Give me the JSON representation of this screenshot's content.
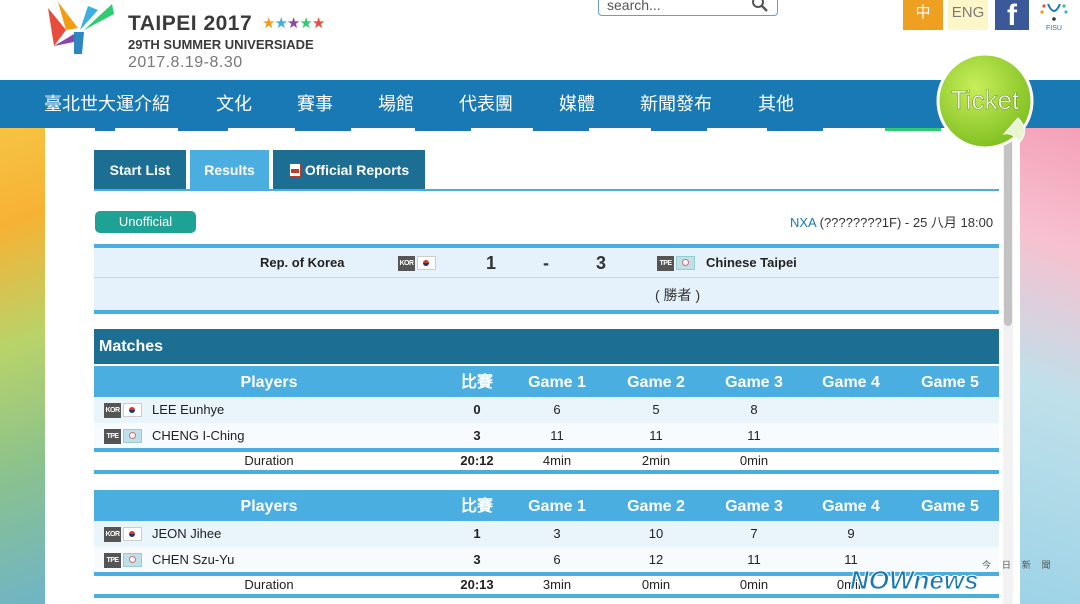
{
  "header": {
    "logo_title": "TAIPEI 2017",
    "logo_subtitle": "29TH SUMMER UNIVERSIADE",
    "logo_dates": "2017.8.19-8.30",
    "search_placeholder": "search...",
    "lang_zh": "中",
    "lang_en": "ENG",
    "fisu_label": "FISU"
  },
  "nav": {
    "items": [
      "臺北世大運介紹",
      "文化",
      "賽事",
      "場館",
      "代表團",
      "媒體",
      "新聞發布",
      "其他"
    ],
    "ticket_label": "Ticket"
  },
  "tabs": {
    "start_list": "Start List",
    "results": "Results",
    "official_reports": "Official Reports"
  },
  "status_badge": "Unofficial",
  "venue": {
    "link": "NXA",
    "detail": " (????????1F) - 25 八月 18:00"
  },
  "score": {
    "team_a": "Rep. of Korea",
    "team_a_code": "KOR",
    "score_a": "1",
    "dash": "-",
    "score_b": "3",
    "team_b": "Chinese Taipei",
    "team_b_code": "TPE",
    "winner_note": "( 勝者 )"
  },
  "matches": {
    "title": "Matches",
    "headers": [
      "Players",
      "比賽",
      "Game 1",
      "Game 2",
      "Game 3",
      "Game 4",
      "Game 5"
    ],
    "duration_label": "Duration",
    "blocks": [
      {
        "rows": [
          {
            "code": "KOR",
            "name": "LEE Eunhye",
            "match": "0",
            "g1": "6",
            "g2": "5",
            "g3": "8",
            "g4": "",
            "g5": ""
          },
          {
            "code": "TPE",
            "name": "CHENG I-Ching",
            "match": "3",
            "g1": "11",
            "g2": "11",
            "g3": "11",
            "g4": "",
            "g5": ""
          }
        ],
        "duration": {
          "total": "20:12",
          "g1": "4min",
          "g2": "2min",
          "g3": "0min",
          "g4": ""
        }
      },
      {
        "rows": [
          {
            "code": "KOR",
            "name": "JEON Jihee",
            "match": "1",
            "g1": "3",
            "g2": "10",
            "g3": "7",
            "g4": "9",
            "g5": ""
          },
          {
            "code": "TPE",
            "name": "CHEN Szu-Yu",
            "match": "3",
            "g1": "6",
            "g2": "12",
            "g3": "11",
            "g4": "11",
            "g5": ""
          }
        ],
        "duration": {
          "total": "20:13",
          "g1": "3min",
          "g2": "0min",
          "g3": "0min",
          "g4": "0min"
        }
      }
    ]
  },
  "watermark": {
    "top": "今 日 新 聞",
    "brand": "NOWnews"
  }
}
